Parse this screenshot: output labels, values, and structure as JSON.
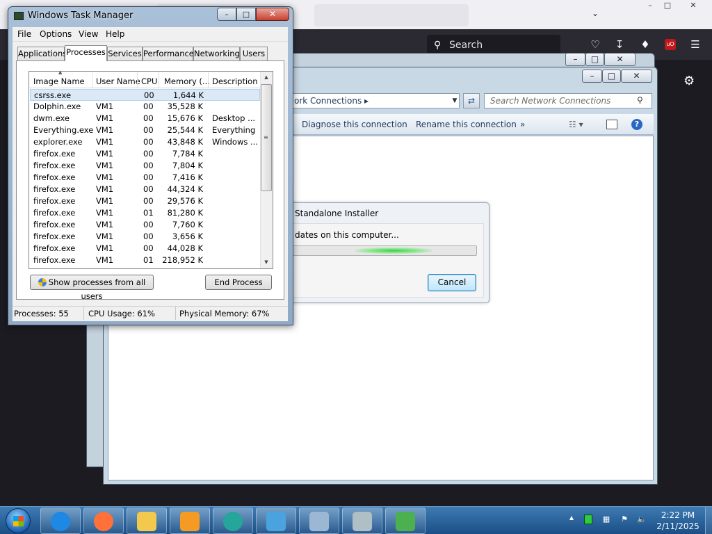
{
  "firefox": {
    "search_label": "Search",
    "window_controls": [
      "–",
      "□",
      "✕"
    ]
  },
  "network_connections": {
    "address": "ork Connections",
    "search_placeholder": "Search Network Connections",
    "commands": [
      "Diagnose this connection",
      "Rename this connection",
      "»"
    ]
  },
  "installer": {
    "title": "Standalone Installer",
    "message": "dates on this computer...",
    "cancel_label": "Cancel"
  },
  "task_manager": {
    "title": "Windows Task Manager",
    "menu": [
      "File",
      "Options",
      "View",
      "Help"
    ],
    "tabs": [
      "Applications",
      "Processes",
      "Services",
      "Performance",
      "Networking",
      "Users"
    ],
    "active_tab": "Processes",
    "columns": [
      "Image Name",
      "User Name",
      "CPU",
      "Memory (...",
      "Description"
    ],
    "rows": [
      {
        "name": "csrss.exe",
        "user": "",
        "cpu": "00",
        "mem": "1,644 K",
        "desc": ""
      },
      {
        "name": "Dolphin.exe",
        "user": "VM1",
        "cpu": "00",
        "mem": "35,528 K",
        "desc": ""
      },
      {
        "name": "dwm.exe",
        "user": "VM1",
        "cpu": "00",
        "mem": "15,676 K",
        "desc": "Desktop ..."
      },
      {
        "name": "Everything.exe",
        "user": "VM1",
        "cpu": "00",
        "mem": "25,544 K",
        "desc": "Everything"
      },
      {
        "name": "explorer.exe",
        "user": "VM1",
        "cpu": "00",
        "mem": "43,848 K",
        "desc": "Windows ..."
      },
      {
        "name": "firefox.exe",
        "user": "VM1",
        "cpu": "00",
        "mem": "7,784 K",
        "desc": ""
      },
      {
        "name": "firefox.exe",
        "user": "VM1",
        "cpu": "00",
        "mem": "7,804 K",
        "desc": ""
      },
      {
        "name": "firefox.exe",
        "user": "VM1",
        "cpu": "00",
        "mem": "7,416 K",
        "desc": ""
      },
      {
        "name": "firefox.exe",
        "user": "VM1",
        "cpu": "00",
        "mem": "44,324 K",
        "desc": ""
      },
      {
        "name": "firefox.exe",
        "user": "VM1",
        "cpu": "00",
        "mem": "29,576 K",
        "desc": ""
      },
      {
        "name": "firefox.exe",
        "user": "VM1",
        "cpu": "01",
        "mem": "81,280 K",
        "desc": ""
      },
      {
        "name": "firefox.exe",
        "user": "VM1",
        "cpu": "00",
        "mem": "7,760 K",
        "desc": ""
      },
      {
        "name": "firefox.exe",
        "user": "VM1",
        "cpu": "00",
        "mem": "3,656 K",
        "desc": ""
      },
      {
        "name": "firefox.exe",
        "user": "VM1",
        "cpu": "00",
        "mem": "44,028 K",
        "desc": ""
      },
      {
        "name": "firefox.exe",
        "user": "VM1",
        "cpu": "01",
        "mem": "218,952 K",
        "desc": ""
      }
    ],
    "show_all_label": "Show processes from all users",
    "end_process_label": "End Process",
    "status": {
      "processes": "Processes: 55",
      "cpu": "CPU Usage: 61%",
      "memory": "Physical Memory: 67%"
    }
  },
  "taskbar": {
    "apps": [
      {
        "icon": "internet-explorer-icon",
        "color": "#1e88e5"
      },
      {
        "icon": "firefox-icon",
        "color": "#ff7139"
      },
      {
        "icon": "folder-icon",
        "color": "#f2c94c"
      },
      {
        "icon": "media-player-icon",
        "color": "#f59b23"
      },
      {
        "icon": "globe-icon",
        "color": "#26a69a"
      },
      {
        "icon": "dolphin-icon",
        "color": "#4aa3df"
      },
      {
        "icon": "control-panel-icon",
        "color": "#9bb7d4"
      },
      {
        "icon": "installer-icon",
        "color": "#b0bec5"
      },
      {
        "icon": "task-manager-icon",
        "color": "#4caf50"
      }
    ],
    "time": "2:22 PM",
    "date": "2/11/2025"
  }
}
